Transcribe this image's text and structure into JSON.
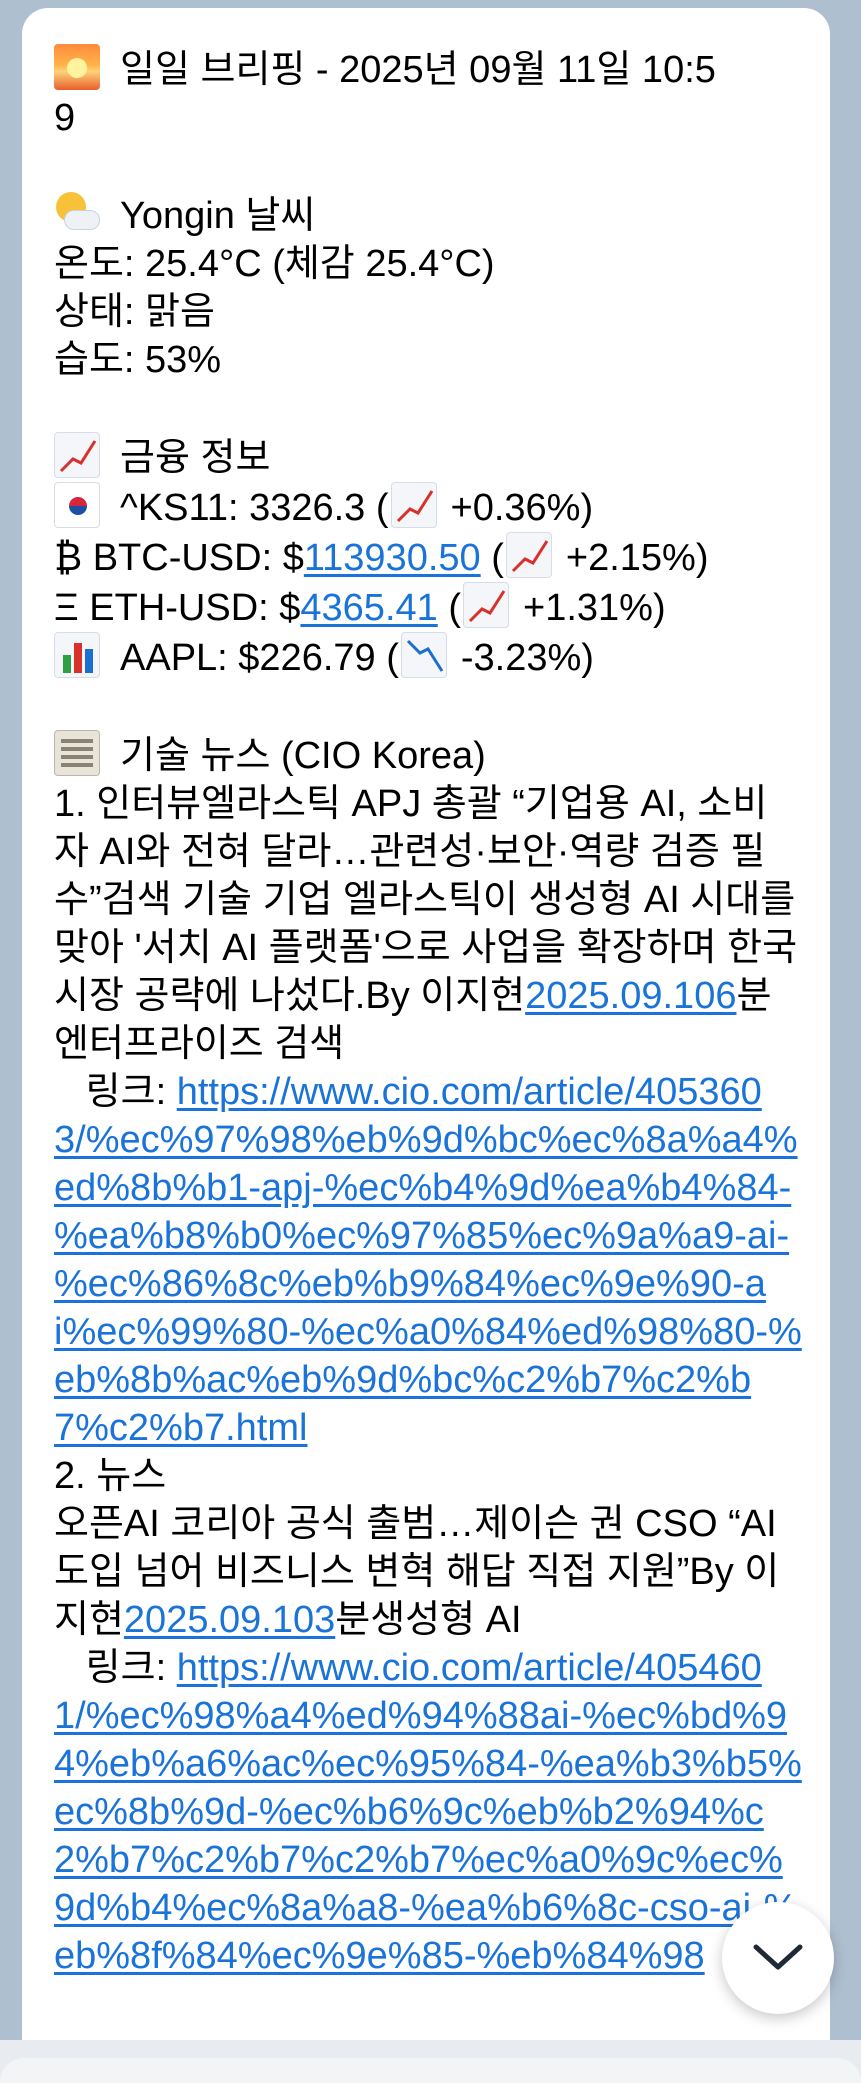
{
  "briefing": {
    "title_line1": "일일 브리핑 - 2025년 09월 11일 10:5",
    "title_line2": "9",
    "weather": {
      "header": "Yongin 날씨",
      "temp": "온도: 25.4°C (체감 25.4°C)",
      "status": "상태: 맑음",
      "humidity": "습도: 53%"
    },
    "finance": {
      "header": "금융 정보",
      "ks11_prefix": "^KS11: 3326.3 (",
      "ks11_suffix": "+0.36%)",
      "btc_symbol": "₿",
      "btc_prefix": "BTC-USD: $",
      "btc_value": "113930.50",
      "btc_open": " (",
      "btc_suffix": "+2.15%)",
      "eth_symbol": "Ξ",
      "eth_prefix": "ETH-USD: $",
      "eth_value": "4365.41",
      "eth_open": " (",
      "eth_suffix": "+1.31%)",
      "aapl_prefix": "AAPL: $226.79 (",
      "aapl_suffix": "-3.23%)"
    },
    "news": {
      "header": "기술 뉴스 (CIO Korea)",
      "item1_text": "1. 인터뷰엘라스틱 APJ 총괄 “기업용 AI, 소비자 AI와 전혀 달라…관련성·보안·역량 검증 필수”검색 기술 기업 엘라스틱이 생성형 AI 시대를 맞아 '서치 AI 플랫폼'으로 사업을 확장하며 한국 시장 공략에 나섰다.By 이지현",
      "item1_date": "2025.09.106",
      "item1_tail": "분엔터프라이즈 검색",
      "item1_link_label": "   링크: ",
      "item1_link": "https://www.cio.com/article/4053603/%ec%97%98%eb%9d%bc%ec%8a%a4%ed%8b%b1-apj-%ec%b4%9d%ea%b4%84-%ea%b8%b0%ec%97%85%ec%9a%a9-ai-%ec%86%8c%eb%b9%84%ec%9e%90-ai%ec%99%80-%ec%a0%84%ed%98%80-%eb%8b%ac%eb%9d%bc%c2%b7%c2%b7%c2%b7.html",
      "item2_title": "2. 뉴스",
      "item2_text": "오픈AI 코리아 공식 출범…제이슨 권 CSO “AI 도입 넘어 비즈니스 변혁 해답 직접 지원”By 이지현",
      "item2_date": "2025.09.103",
      "item2_tail": "분생성형 AI",
      "item2_link_label": "   링크: ",
      "item2_link": "https://www.cio.com/article/4054601/%ec%98%a4%ed%94%88ai-%ec%bd%94%eb%a6%ac%ec%95%84-%ea%b3%b5%ec%8b%9d-%ec%b6%9c%eb%b2%94%c2%b7%c2%b7%c2%b7%ec%a0%9c%ec%9d%b4%ec%8a%a8-%ea%b6%8c-cso-ai-%eb%8f%84%ec%9e%85-%eb%84%98"
    }
  },
  "icons": {
    "title": "sunrise-icon",
    "weather": "sun-behind-cloud-icon",
    "finance": "chart-increasing-icon",
    "korea": "korea-flag-icon",
    "aapl": "bar-chart-icon",
    "news": "newspaper-icon",
    "scroll": "chevron-down-icon"
  },
  "colors": {
    "link": "#1a73d9",
    "background": "#aebfd0",
    "bubble": "#ffffff"
  }
}
